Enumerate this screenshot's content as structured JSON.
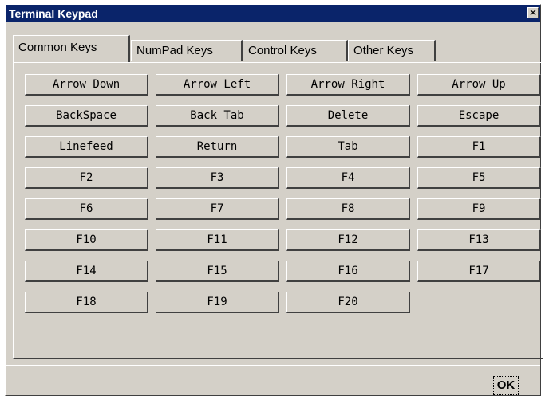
{
  "window": {
    "title": "Terminal Keypad",
    "close_label": "✕"
  },
  "tabs": [
    {
      "label": "Common Keys",
      "active": true
    },
    {
      "label": "NumPad Keys",
      "active": false
    },
    {
      "label": "Control Keys",
      "active": false
    },
    {
      "label": "Other Keys",
      "active": false
    }
  ],
  "keys": [
    [
      "Arrow Down",
      "Arrow Left",
      "Arrow Right",
      "Arrow Up"
    ],
    [
      "BackSpace",
      "Back Tab",
      "Delete",
      "Escape"
    ],
    [
      "Linefeed",
      "Return",
      "Tab",
      "F1"
    ],
    [
      "F2",
      "F3",
      "F4",
      "F5"
    ],
    [
      "F6",
      "F7",
      "F8",
      "F9"
    ],
    [
      "F10",
      "F11",
      "F12",
      "F13"
    ],
    [
      "F14",
      "F15",
      "F16",
      "F17"
    ],
    [
      "F18",
      "F19",
      "F20"
    ]
  ],
  "footer": {
    "ok_label": "OK"
  },
  "colors": {
    "title_bar": "#0a246a",
    "face": "#d4d0c8"
  }
}
